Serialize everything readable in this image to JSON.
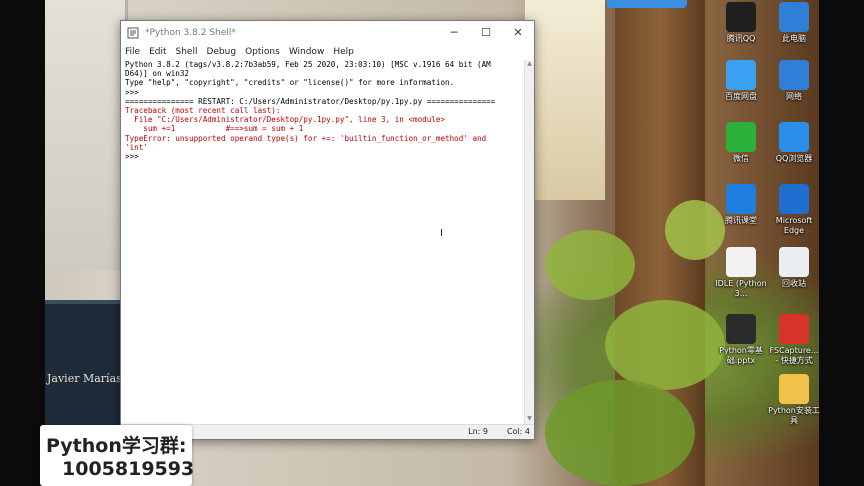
{
  "window": {
    "title": "*Python 3.8.2 Shell*",
    "minimize": "─",
    "maximize": "☐",
    "close": "✕",
    "menu": [
      "File",
      "Edit",
      "Shell",
      "Debug",
      "Options",
      "Window",
      "Help"
    ]
  },
  "shell": {
    "lines": [
      {
        "text": "Python 3.8.2 (tags/v3.8.2:7b3ab59, Feb 25 2020, 23:03:10) [MSC v.1916 64 bit (AM",
        "style": "normal"
      },
      {
        "text": "D64)] on win32",
        "style": "normal"
      },
      {
        "text": "Type \"help\", \"copyright\", \"credits\" or \"license()\" for more information.",
        "style": "normal"
      },
      {
        "text": ">>> ",
        "style": "normal"
      },
      {
        "text": "=============== RESTART: C:/Users/Administrator/Desktop/py.1py.py ===============",
        "style": "normal"
      },
      {
        "text": "Traceback (most recent call last):",
        "style": "err"
      },
      {
        "text": "  File \"C:/Users/Administrator/Desktop/py.1py.py\", line 3, in <module>",
        "style": "err"
      },
      {
        "text": "    sum +=1           #==>sum = sum + 1",
        "style": "err"
      },
      {
        "text": "TypeError: unsupported operand type(s) for +=: 'builtin_function_or_method' and",
        "style": "err"
      },
      {
        "text": "'int'",
        "style": "err"
      },
      {
        "text": ">>> ",
        "style": "normal"
      }
    ]
  },
  "status": {
    "ln": "Ln: 9",
    "col": "Col: 4"
  },
  "desktop_icons": [
    {
      "label": "腾讯QQ",
      "icon": "qq-icon",
      "color": "#1f1f1f"
    },
    {
      "label": "此电脑",
      "icon": "computer-icon",
      "color": "#2f7fd6"
    },
    {
      "label": "百度网盘",
      "icon": "baidu-netdisk-icon",
      "color": "#3aa0f0"
    },
    {
      "label": "网络",
      "icon": "network-icon",
      "color": "#2f7fd6"
    },
    {
      "label": "微信",
      "icon": "wechat-icon",
      "color": "#2bb03a"
    },
    {
      "label": "QQ浏览器",
      "icon": "qq-browser-icon",
      "color": "#2b8ee8"
    },
    {
      "label": "腾讯课堂",
      "icon": "tencent-classroom-icon",
      "color": "#1f7fe0"
    },
    {
      "label": "Microsoft Edge",
      "icon": "edge-icon",
      "color": "#1f6fd0"
    },
    {
      "label": "IDLE (Python 3...",
      "icon": "idle-icon",
      "color": "#f2f2f2"
    },
    {
      "label": "回收站",
      "icon": "recycle-bin-icon",
      "color": "#e9eef3"
    },
    {
      "label": "Python零基础.pptx",
      "icon": "pptx-file-icon",
      "color": "#2b2b2b"
    },
    {
      "label": "FSCapture... - 快捷方式",
      "icon": "fscapture-icon",
      "color": "#d8332a"
    },
    {
      "label": "Python安装工具",
      "icon": "folder-icon",
      "color": "#f0c24b"
    }
  ],
  "background": {
    "book_title": "Javier Marías"
  },
  "promo": {
    "line1": "Python学习群:",
    "line2": "1005819593"
  }
}
